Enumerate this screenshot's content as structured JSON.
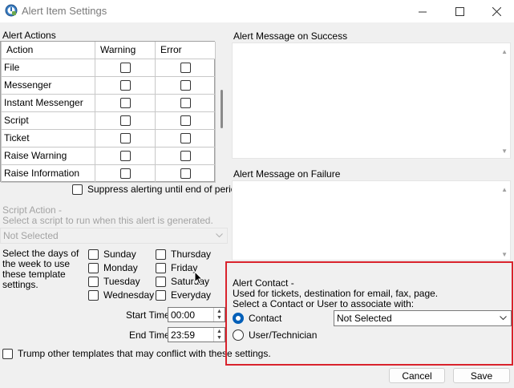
{
  "window": {
    "title": "Alert Item Settings",
    "minimize_icon": "minimize-icon",
    "maximize_icon": "maximize-icon",
    "close_icon": "close-icon"
  },
  "alert_actions": {
    "group_label": "Alert Actions",
    "columns": [
      "Action",
      "Warning",
      "Error"
    ],
    "rows": [
      {
        "action": "File",
        "warning": false,
        "error": false
      },
      {
        "action": "Messenger",
        "warning": false,
        "error": false
      },
      {
        "action": "Instant Messenger",
        "warning": false,
        "error": false
      },
      {
        "action": "Script",
        "warning": false,
        "error": false
      },
      {
        "action": "Ticket",
        "warning": false,
        "error": false
      },
      {
        "action": "Raise Warning",
        "warning": false,
        "error": false
      },
      {
        "action": "Raise Information",
        "warning": false,
        "error": false
      }
    ]
  },
  "suppress": {
    "label": "Suppress alerting until end of period",
    "checked": false
  },
  "script_action": {
    "title": "Script Action -",
    "description": "Select a script to run when this alert is generated.",
    "selected": "Not Selected"
  },
  "schedule": {
    "description": "Select the days of the week to use these template settings.",
    "days": [
      {
        "label": "Sunday",
        "checked": false
      },
      {
        "label": "Thursday",
        "checked": false
      },
      {
        "label": "Monday",
        "checked": false
      },
      {
        "label": "Friday",
        "checked": false
      },
      {
        "label": "Tuesday",
        "checked": false
      },
      {
        "label": "Saturday",
        "checked": false
      },
      {
        "label": "Wednesday",
        "checked": false
      },
      {
        "label": "Everyday",
        "checked": false
      }
    ],
    "start_label": "Start Time",
    "start_value": "00:00",
    "end_label": "End Time",
    "end_value": "23:59"
  },
  "trump": {
    "label": "Trump other templates that may conflict with these settings.",
    "checked": false
  },
  "success_message": {
    "label": "Alert Message on Success",
    "value": ""
  },
  "failure_message": {
    "label": "Alert Message on Failure",
    "value": ""
  },
  "alert_contact": {
    "title": "Alert Contact -",
    "line1": "Used for tickets, destination for email, fax, page.",
    "line2": "Select a Contact or User to associate with:",
    "contact_label": "Contact",
    "contact_selected": true,
    "user_label": "User/Technician",
    "user_selected": false,
    "contact_value": "Not Selected",
    "highlight_color": "#d9232d"
  },
  "buttons": {
    "cancel": "Cancel",
    "save": "Save"
  },
  "colors": {
    "accent": "#005fb8"
  }
}
